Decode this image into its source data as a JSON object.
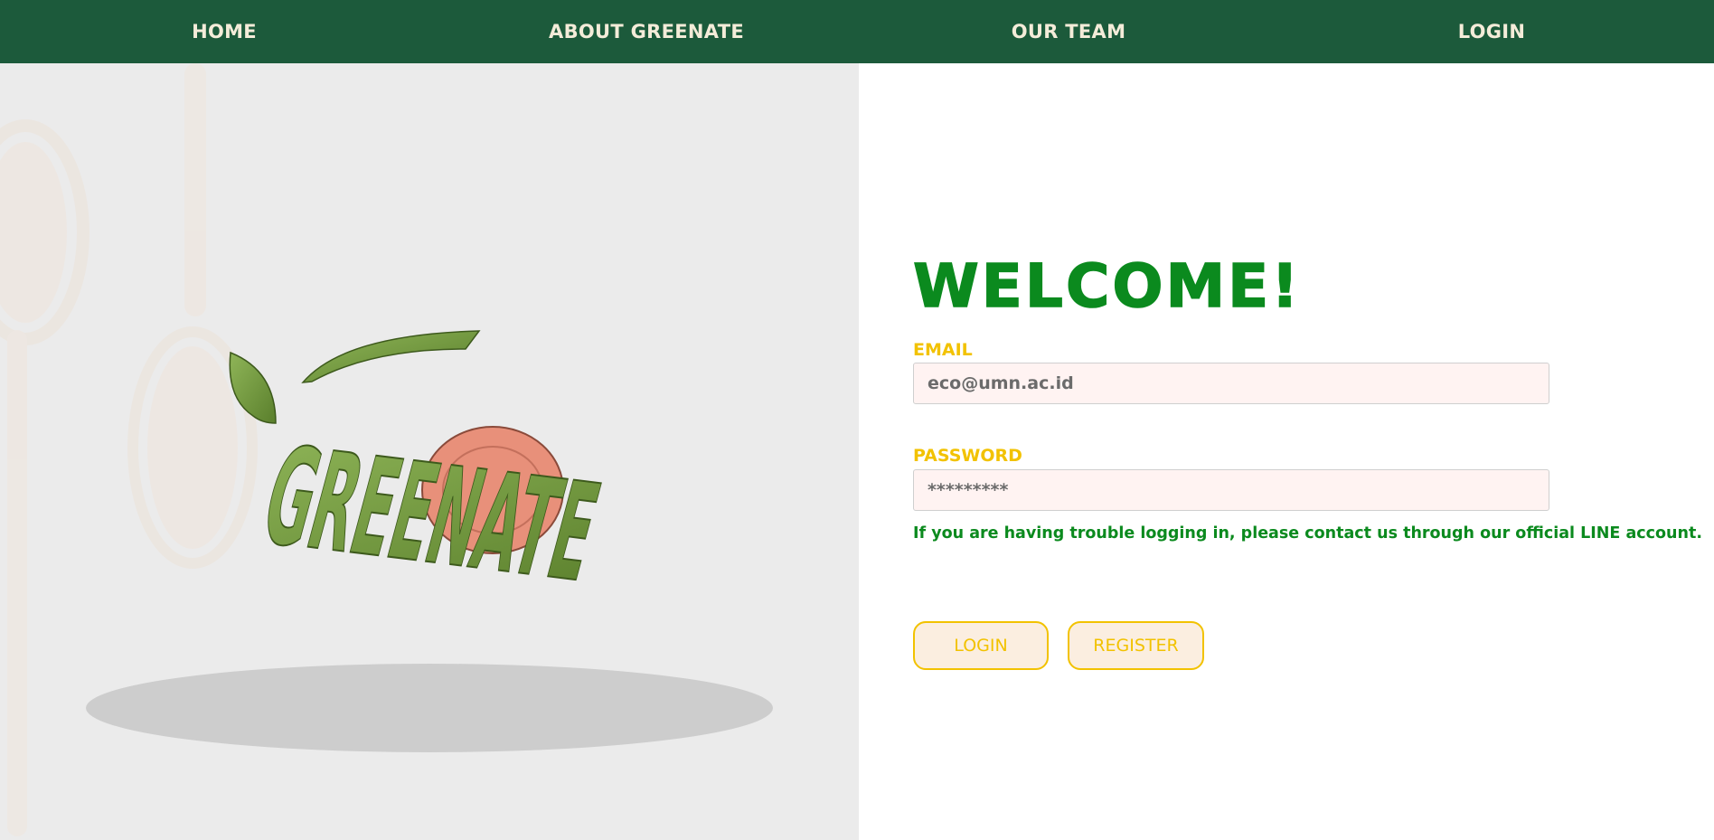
{
  "nav": {
    "items": [
      {
        "label": "HOME"
      },
      {
        "label": "ABOUT GREENATE"
      },
      {
        "label": "OUR TEAM"
      },
      {
        "label": "LOGIN"
      }
    ]
  },
  "brand": {
    "logo_text": "GREENATE"
  },
  "form": {
    "title": "WELCOME!",
    "email_label": "EMAIL",
    "email_placeholder": "eco@umn.ac.id",
    "password_label": "PASSWORD",
    "password_placeholder": "*********",
    "help_text": "If you are having trouble logging in, please contact us through our official LINE account.",
    "login_button": "LOGIN",
    "register_button": "REGISTER"
  },
  "colors": {
    "nav_background": "#1c5a3b",
    "nav_text": "#f4ecd9",
    "title_green": "#0b8a1e",
    "label_yellow": "#f2c200",
    "input_background": "#fff3f2",
    "button_background": "#fbeee0",
    "left_panel_background": "#ebebeb",
    "logo_green": "#6f9a3e",
    "logo_peach": "#e8907a"
  }
}
